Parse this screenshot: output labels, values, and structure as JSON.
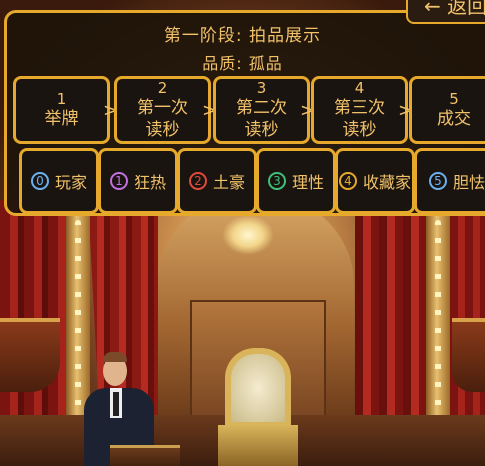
{
  "header": {
    "stage_text": "第一阶段: 拍品展示",
    "quality_text": "品质: 孤品",
    "back_label": "← 返回"
  },
  "steps": [
    {
      "num": "1",
      "label": "举牌",
      "label2": ""
    },
    {
      "num": "2",
      "label": "第一次",
      "label2": "读秒"
    },
    {
      "num": "3",
      "label": "第二次",
      "label2": "读秒"
    },
    {
      "num": "4",
      "label": "第三次",
      "label2": "读秒"
    },
    {
      "num": "5",
      "label": "成交",
      "label2": ""
    }
  ],
  "step_separator": ">",
  "players": [
    {
      "id": "0",
      "name": "玩家",
      "color": "#6ab0f0"
    },
    {
      "id": "1",
      "name": "狂热",
      "color": "#c070e0"
    },
    {
      "id": "2",
      "name": "土豪",
      "color": "#e04a3a"
    },
    {
      "id": "3",
      "name": "理性",
      "color": "#3ec07a"
    },
    {
      "id": "4",
      "name": "收藏家",
      "color": "#e6a92b"
    },
    {
      "id": "5",
      "name": "胆怯",
      "color": "#6ab0f0"
    }
  ],
  "colors": {
    "accent": "#e6a92b",
    "text": "#f2c26a",
    "panel": "#1a1410"
  },
  "icons": {
    "back": "left-arrow-icon",
    "separator": "chevron-right-icon"
  }
}
